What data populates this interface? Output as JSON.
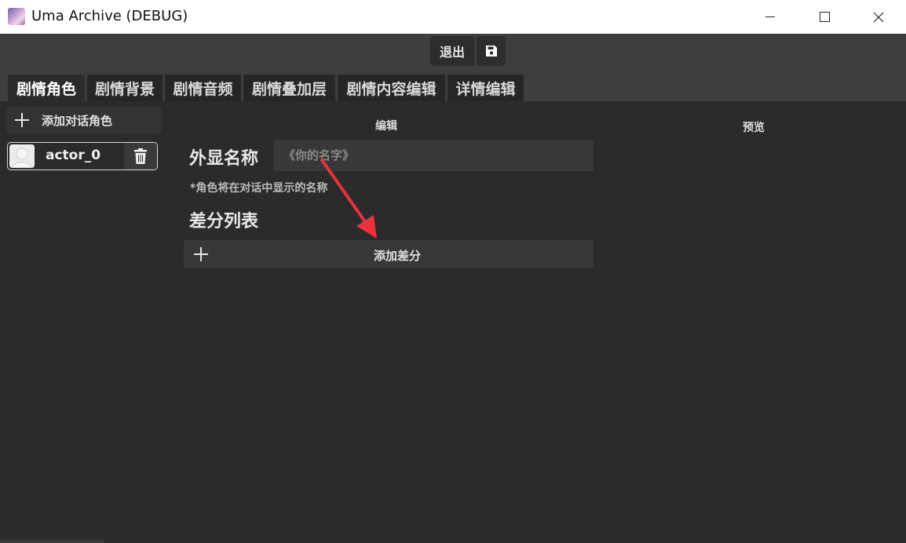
{
  "window": {
    "title": "Uma Archive (DEBUG)"
  },
  "toolbar": {
    "exit_label": "退出"
  },
  "tabs": [
    {
      "label": "剧情角色"
    },
    {
      "label": "剧情背景"
    },
    {
      "label": "剧情音频"
    },
    {
      "label": "剧情叠加层"
    },
    {
      "label": "剧情内容编辑"
    },
    {
      "label": "详情编辑"
    }
  ],
  "sidebar": {
    "add_actor_label": "添加对话角色",
    "actors": [
      {
        "name": "actor_0"
      }
    ]
  },
  "editor": {
    "section_title": "编辑",
    "preview_title": "预览",
    "display_name_label": "外显名称",
    "display_name_placeholder": "《你的名字》",
    "display_name_value": "",
    "hint": "*角色将在对话中显示的名称",
    "diff_list_title": "差分列表",
    "add_diff_label": "添加差分"
  },
  "colors": {
    "accent_arrow": "#e8323c",
    "background": "#2b2b2b",
    "toolbar": "#3e3e3e"
  }
}
